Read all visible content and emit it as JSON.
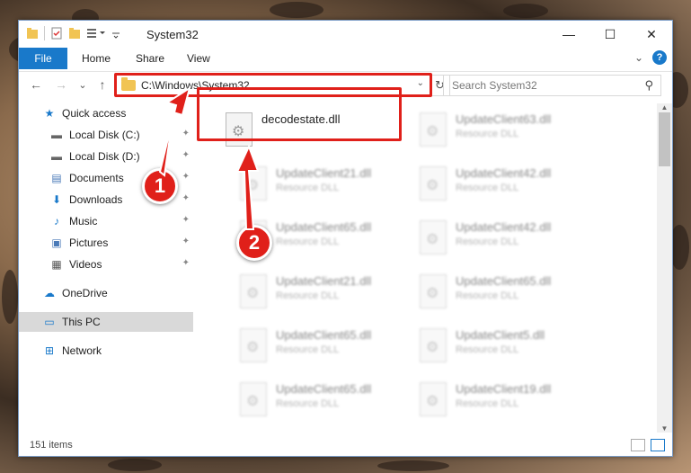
{
  "window": {
    "title": "System32",
    "controls": {
      "minimize": "—",
      "maximize": "☐",
      "close": "✕"
    }
  },
  "ribbon": {
    "file_tab": "File",
    "tabs": [
      "Home",
      "Share",
      "View"
    ],
    "expand_glyph": "⌄",
    "help_glyph": "?"
  },
  "navigation": {
    "back_glyph": "←",
    "forward_glyph": "→",
    "recent_glyph": "⌄",
    "up_glyph": "↑",
    "address": "C:\\Windows\\System32",
    "address_drop_glyph": "⌄",
    "refresh_glyph": "↻",
    "search_placeholder": "Search System32",
    "search_glyph": "⚲"
  },
  "sidebar": {
    "items": [
      {
        "label": "Quick access",
        "icon": "star-icon",
        "glyph": "★",
        "color": "#1979ca",
        "pinned": false
      },
      {
        "label": "Local Disk (C:)",
        "icon": "drive-icon",
        "glyph": "▬",
        "color": "#666666",
        "pinned": true
      },
      {
        "label": "Local Disk (D:)",
        "icon": "drive-icon",
        "glyph": "▬",
        "color": "#666666",
        "pinned": true
      },
      {
        "label": "Documents",
        "icon": "documents-icon",
        "glyph": "▤",
        "color": "#4a7ab8",
        "pinned": true
      },
      {
        "label": "Downloads",
        "icon": "download-icon",
        "glyph": "⬇",
        "color": "#1979ca",
        "pinned": true
      },
      {
        "label": "Music",
        "icon": "music-icon",
        "glyph": "♪",
        "color": "#1979ca",
        "pinned": true
      },
      {
        "label": "Pictures",
        "icon": "pictures-icon",
        "glyph": "▣",
        "color": "#4a7ab8",
        "pinned": true
      },
      {
        "label": "Videos",
        "icon": "videos-icon",
        "glyph": "▦",
        "color": "#555555",
        "pinned": true
      },
      {
        "label": "OneDrive",
        "icon": "cloud-icon",
        "glyph": "☁",
        "color": "#1979ca",
        "pinned": false
      },
      {
        "label": "This PC",
        "icon": "computer-icon",
        "glyph": "▭",
        "color": "#1979ca",
        "pinned": false,
        "selected": true
      },
      {
        "label": "Network",
        "icon": "network-icon",
        "glyph": "⊞",
        "color": "#1979ca",
        "pinned": false
      }
    ],
    "pin_glyph": "📌"
  },
  "files": {
    "highlighted": {
      "name": "decodestate.dll",
      "type": ""
    },
    "others": [
      {
        "name": "UpdateClient63.dll",
        "type": "Resource DLL"
      },
      {
        "name": "UpdateClient21.dll",
        "type": "Resource DLL"
      },
      {
        "name": "UpdateClient42.dll",
        "type": "Resource DLL"
      },
      {
        "name": "UpdateClient65.dll",
        "type": "Resource DLL"
      },
      {
        "name": "UpdateClient42.dll",
        "type": "Resource DLL"
      },
      {
        "name": "UpdateClient21.dll",
        "type": "Resource DLL"
      },
      {
        "name": "UpdateClient65.dll",
        "type": "Resource DLL"
      },
      {
        "name": "UpdateClient65.dll",
        "type": "Resource DLL"
      },
      {
        "name": "UpdateClient5.dll",
        "type": "Resource DLL"
      },
      {
        "name": "UpdateClient65.dll",
        "type": "Resource DLL"
      },
      {
        "name": "UpdateClient19.dll",
        "type": "Resource DLL"
      }
    ]
  },
  "status": {
    "item_count": "151 items"
  },
  "markers": {
    "one": "1",
    "two": "2"
  },
  "colors": {
    "accent": "#1979ca",
    "highlight": "#e0201a"
  }
}
